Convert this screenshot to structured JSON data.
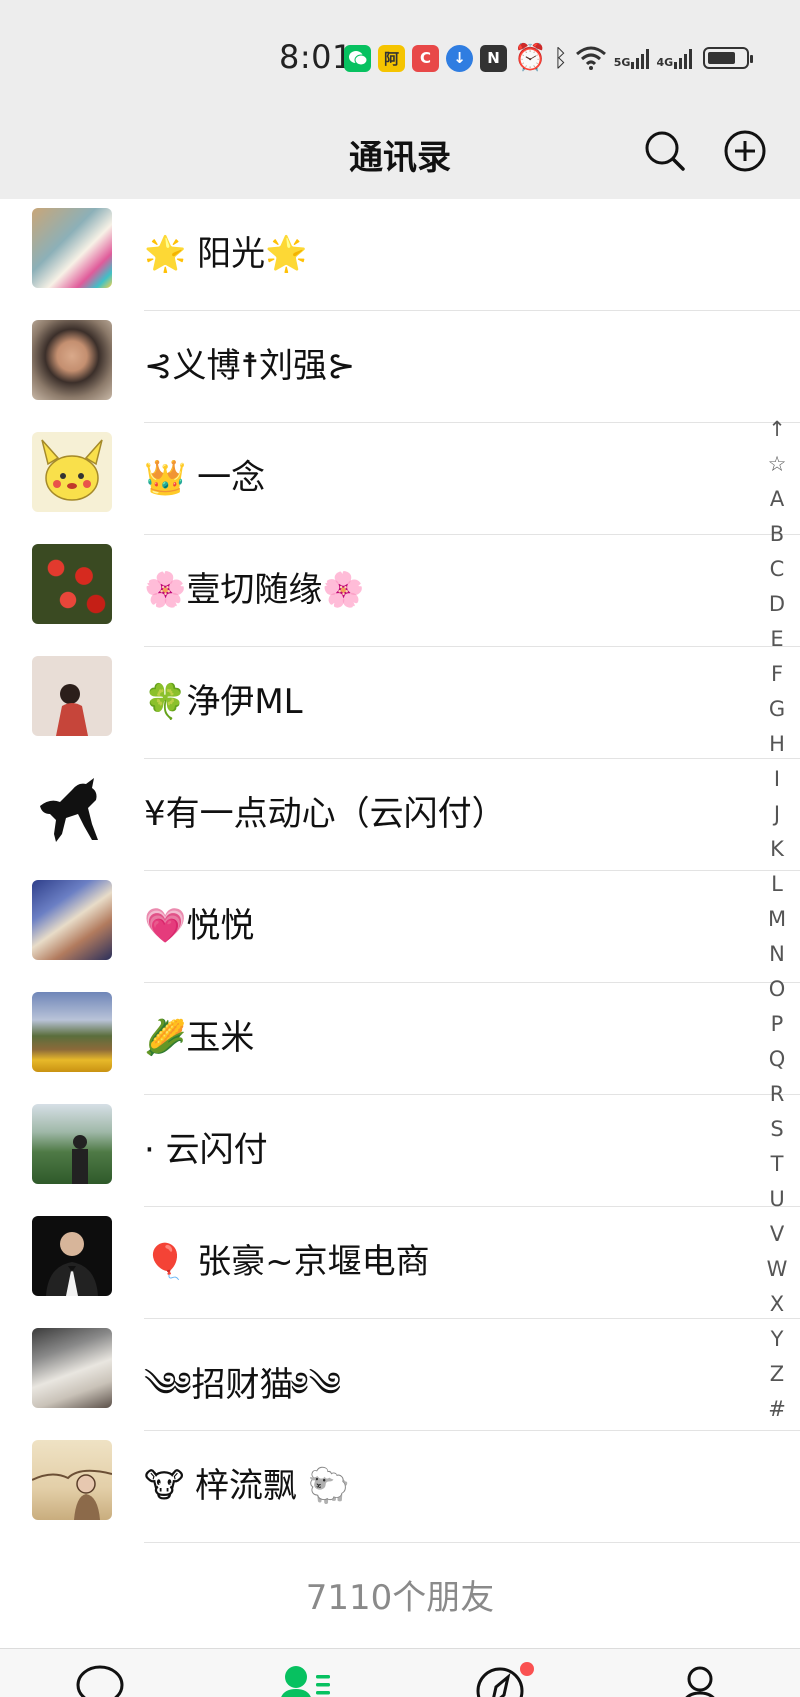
{
  "status_bar": {
    "time": "8:01",
    "network_1": "5G",
    "network_2": "4G",
    "battery_level": 0.65
  },
  "header": {
    "title": "通讯录"
  },
  "contacts": [
    {
      "name": "🌟 阳光🌟",
      "avatar": "room-photo"
    },
    {
      "name": "⊰义博☨刘强⊱",
      "avatar": "man-portrait"
    },
    {
      "name": "👑 一念",
      "avatar": "cartoon-pikachu"
    },
    {
      "name": "🌸壹切随缘🌸",
      "avatar": "red-berries"
    },
    {
      "name": "🍀浄伊ML",
      "avatar": "girl-red-coat"
    },
    {
      "name": "¥有一点动心（云闪付）",
      "avatar": "black-horse"
    },
    {
      "name": "💗悦悦",
      "avatar": "anime-art"
    },
    {
      "name": "🌽玉米",
      "avatar": "landscape-village"
    },
    {
      "name": "· 云闪付",
      "avatar": "mountain-man"
    },
    {
      "name": "🎈 张豪~京堰电商",
      "avatar": "man-in-suit"
    },
    {
      "name": "༄༅招财猫༅༄",
      "avatar": "book-photo"
    },
    {
      "name": "🐮 梓流飘 🐑",
      "avatar": "ink-painting"
    }
  ],
  "alpha_index": [
    "↑",
    "☆",
    "A",
    "B",
    "C",
    "D",
    "E",
    "F",
    "G",
    "H",
    "I",
    "J",
    "K",
    "L",
    "M",
    "N",
    "O",
    "P",
    "Q",
    "R",
    "S",
    "T",
    "U",
    "V",
    "W",
    "X",
    "Y",
    "Z",
    "#"
  ],
  "friend_count": "7110个朋友",
  "colors": {
    "header_bg": "#ededed",
    "accent_green": "#07c160",
    "badge_red": "#fa5151"
  },
  "tabs": [
    {
      "name": "chats",
      "icon": "chat-bubble-icon"
    },
    {
      "name": "contacts",
      "icon": "contacts-icon",
      "active": true
    },
    {
      "name": "discover",
      "icon": "compass-icon",
      "badge": true
    },
    {
      "name": "me",
      "icon": "person-icon"
    }
  ]
}
